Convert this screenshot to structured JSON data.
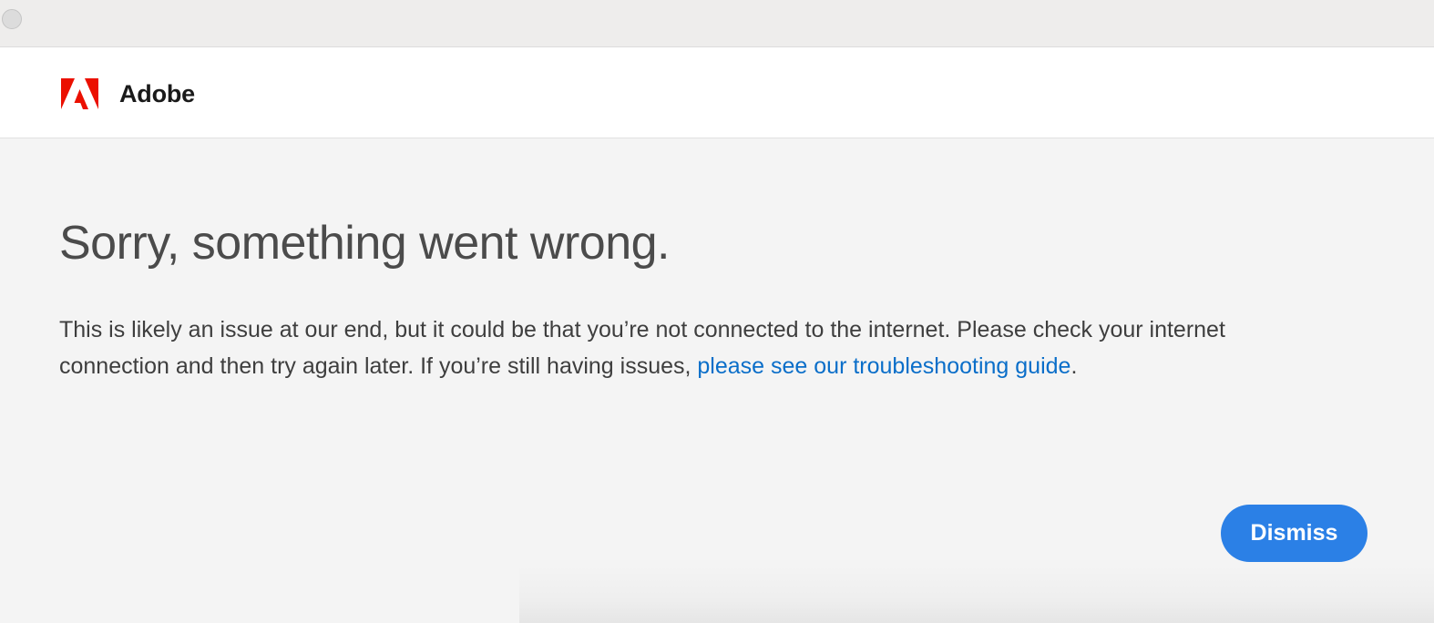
{
  "window": {
    "traffic_light_color": "#dcdcdc"
  },
  "header": {
    "logo_icon": "adobe-logo-icon",
    "brand_name": "Adobe",
    "brand_color": "#eb1000"
  },
  "error": {
    "heading": "Sorry, something went wrong.",
    "message_before_link": "This is likely an issue at our end, but it could be that you’re not connected to the internet. Please check your internet connection and then try again later. If you’re still having issues, ",
    "link_text": "please see our troubleshooting guide",
    "message_after_link": ".",
    "link_color": "#0a6ec9"
  },
  "actions": {
    "dismiss_label": "Dismiss",
    "dismiss_color": "#2b80e6"
  }
}
